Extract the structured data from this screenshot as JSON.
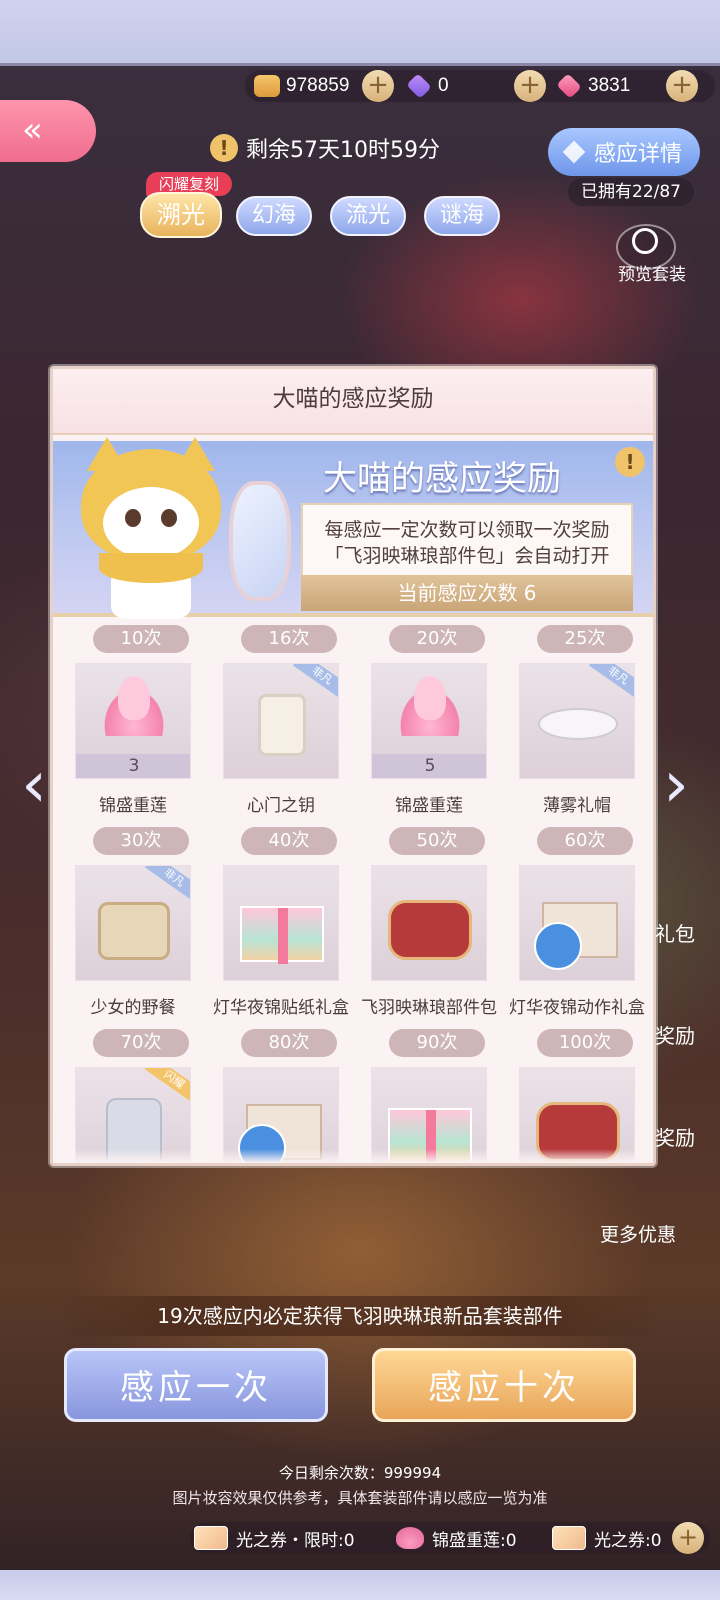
{
  "currency": {
    "gold": "978859",
    "purple_diamond": "0",
    "pink_diamond": "3831",
    "plus": "+"
  },
  "back": {
    "label": "«"
  },
  "timer": {
    "icon": "!",
    "text": "剩余57天10时59分"
  },
  "detail": {
    "label": "感应详情",
    "owned": "已拥有22/87"
  },
  "preview": {
    "label": "预览套装"
  },
  "pools": {
    "flash_tag": "闪耀复刻",
    "tabs": [
      "溯光",
      "幻海",
      "流光",
      "谜海"
    ]
  },
  "side_labels": [
    "礼包",
    "奖励",
    "奖励",
    "更多优惠"
  ],
  "modal": {
    "header": "大喵的感应奖励",
    "banner_title": "大喵的感应奖励",
    "info": "!",
    "desc_line1": "每感应一定次数可以领取一次奖励",
    "desc_line2": "「飞羽映琳琅部件包」会自动打开",
    "current_count": "当前感应次数 6",
    "rewards": [
      {
        "count": "10次",
        "name": "锦盛重莲",
        "qty": "3"
      },
      {
        "count": "16次",
        "name": "心门之钥",
        "badge": "非凡"
      },
      {
        "count": "20次",
        "name": "锦盛重莲",
        "qty": "5"
      },
      {
        "count": "25次",
        "name": "薄雾礼帽",
        "badge": "非凡"
      },
      {
        "count": "30次",
        "name": "少女的野餐",
        "badge": "非凡"
      },
      {
        "count": "40次",
        "name": "灯华夜锦贴纸礼盒"
      },
      {
        "count": "50次",
        "name": "飞羽映琳琅部件包"
      },
      {
        "count": "60次",
        "name": "灯华夜锦动作礼盒"
      },
      {
        "count": "70次",
        "name": "",
        "badge": "闪耀"
      },
      {
        "count": "80次",
        "name": ""
      },
      {
        "count": "90次",
        "name": ""
      },
      {
        "count": "100次",
        "name": ""
      }
    ]
  },
  "bottom": {
    "guarantee": "19次感应内必定获得飞羽映琳琅新品套装部件",
    "draw_one": "感应一次",
    "draw_ten": "感应十次",
    "remaining": "今日剩余次数：999994",
    "disclaimer": "图片妆容效果仅供参考，具体套装部件请以感应一览为准",
    "ticket_limited": "光之券・限时:0",
    "lotus": "锦盛重莲:0",
    "ticket": "光之券:0"
  },
  "colors": {
    "back_button": "#ef6d8e",
    "detail_button": "#6e97ea",
    "draw_one": "#8896de",
    "draw_ten": "#e8a55a",
    "flash_tag": "#e83e57"
  }
}
